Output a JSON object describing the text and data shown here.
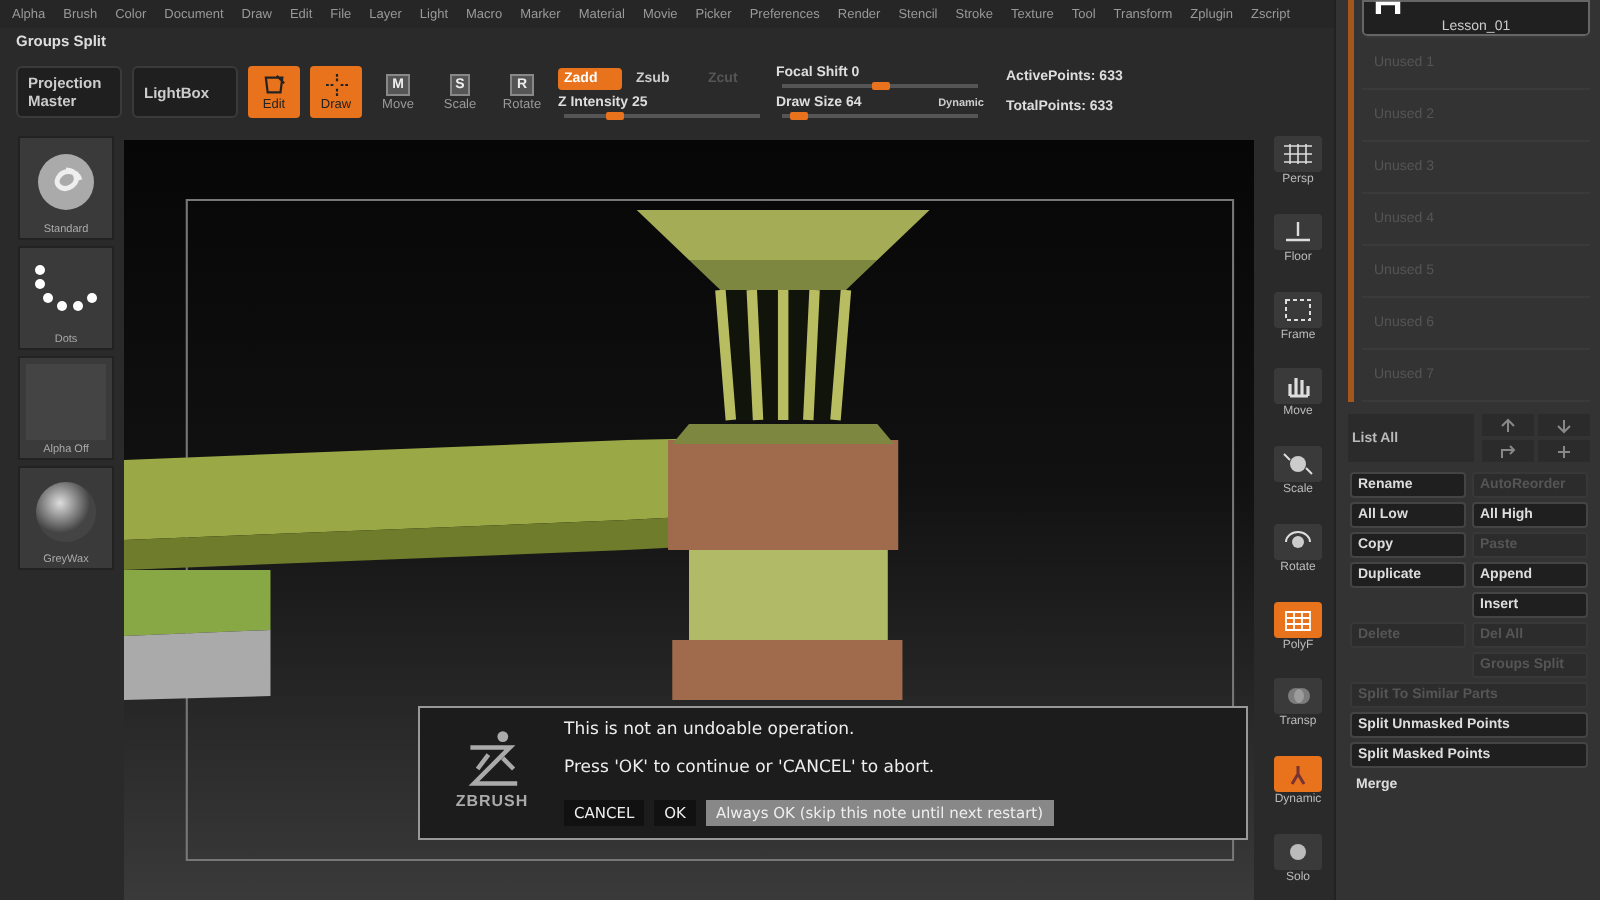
{
  "menu": [
    "Alpha",
    "Brush",
    "Color",
    "Document",
    "Draw",
    "Edit",
    "File",
    "Layer",
    "Light",
    "Macro",
    "Marker",
    "Material",
    "Movie",
    "Picker",
    "Preferences",
    "Render",
    "Stencil",
    "Stroke",
    "Texture",
    "Tool",
    "Transform",
    "Zplugin",
    "Zscript"
  ],
  "palette_title": "Groups Split",
  "toolbar": {
    "buttons": [
      {
        "label": "Projection Master"
      },
      {
        "label": "LightBox"
      }
    ],
    "modes": [
      {
        "label": "Edit",
        "kind": "edit",
        "selected": true
      },
      {
        "label": "Draw",
        "kind": "draw",
        "selected": true
      },
      {
        "label": "Move",
        "kind": "key",
        "key": "M",
        "selected": false
      },
      {
        "label": "Scale",
        "kind": "key",
        "key": "S",
        "selected": false
      },
      {
        "label": "Rotate",
        "kind": "key",
        "key": "R",
        "selected": false
      }
    ],
    "zmodes": [
      {
        "label": "Zadd",
        "selected": true,
        "disabled": false
      },
      {
        "label": "Zsub",
        "selected": false,
        "disabled": false
      },
      {
        "label": "Zcut",
        "selected": false,
        "disabled": true
      }
    ],
    "sliders": [
      {
        "label": "Z Intensity 25",
        "level": 0.25
      },
      {
        "label": "Focal Shift 0",
        "level": 0.5
      },
      {
        "label": "Draw Size 64",
        "level": 0.08
      }
    ],
    "dynamic": "Dynamic",
    "stats": [
      "ActivePoints: 633",
      "TotalPoints: 633"
    ]
  },
  "brushes": [
    {
      "label": "Standard",
      "kind": "swirl"
    },
    {
      "label": "Dots",
      "kind": "dots"
    },
    {
      "label": "Alpha Off",
      "kind": "blank"
    },
    {
      "label": "GreyWax",
      "kind": "sphere"
    }
  ],
  "shelf": [
    {
      "label": "Persp",
      "kind": "grid",
      "selected": false
    },
    {
      "label": "Floor",
      "kind": "floor",
      "selected": false
    },
    {
      "label": "Frame",
      "kind": "frame",
      "selected": false
    },
    {
      "label": "Move",
      "kind": "hand",
      "selected": false
    },
    {
      "label": "Scale",
      "kind": "scale",
      "selected": false
    },
    {
      "label": "Rotate",
      "kind": "rotate",
      "selected": false
    },
    {
      "label": "PolyF",
      "kind": "polyf",
      "selected": true
    },
    {
      "label": "Transp",
      "kind": "transp",
      "selected": false
    },
    {
      "label": "Dynamic",
      "kind": "dynamic",
      "selected": true
    },
    {
      "label": "Solo",
      "kind": "solo",
      "selected": false
    }
  ],
  "subtools": [
    {
      "label": "Lesson_01",
      "selected": true
    },
    {
      "label": "Unused 1",
      "selected": false
    },
    {
      "label": "Unused 2",
      "selected": false
    },
    {
      "label": "Unused 3",
      "selected": false
    },
    {
      "label": "Unused 4",
      "selected": false
    },
    {
      "label": "Unused 5",
      "selected": false
    },
    {
      "label": "Unused 6",
      "selected": false
    },
    {
      "label": "Unused 7",
      "selected": false
    }
  ],
  "list_all": "List All",
  "actions": [
    {
      "label": "Rename",
      "kind": "half",
      "disabled": false
    },
    {
      "label": "AutoReorder",
      "kind": "half",
      "disabled": true
    },
    {
      "label": "All Low",
      "kind": "half",
      "disabled": false
    },
    {
      "label": "All High",
      "kind": "half",
      "disabled": false
    },
    {
      "label": "Copy",
      "kind": "half",
      "disabled": false
    },
    {
      "label": "Paste",
      "kind": "half",
      "disabled": true
    },
    {
      "label": "Duplicate",
      "kind": "half",
      "disabled": false
    },
    {
      "label": "Append",
      "kind": "half",
      "disabled": false
    },
    {
      "label": "Insert",
      "kind": "right",
      "disabled": false
    },
    {
      "label": "Delete",
      "kind": "half",
      "disabled": true
    },
    {
      "label": "Del All",
      "kind": "half",
      "disabled": true
    },
    {
      "label": "Groups Split",
      "kind": "right",
      "disabled": true
    },
    {
      "label": "Split To Similar Parts",
      "kind": "wide",
      "disabled": true
    },
    {
      "label": "Split Unmasked Points",
      "kind": "wide",
      "disabled": false
    },
    {
      "label": "Split Masked Points",
      "kind": "wide",
      "disabled": false
    },
    {
      "label": "Merge",
      "kind": "plain",
      "disabled": false
    }
  ],
  "dialog": {
    "logo": "ZBRUSH",
    "lines": [
      "This is not an undoable operation.",
      "Press 'OK' to continue or 'CANCEL' to abort."
    ],
    "buttons": [
      {
        "label": "CANCEL",
        "selected": false
      },
      {
        "label": "OK",
        "selected": false
      },
      {
        "label": "Always OK (skip this note until next restart)",
        "selected": true
      }
    ]
  }
}
